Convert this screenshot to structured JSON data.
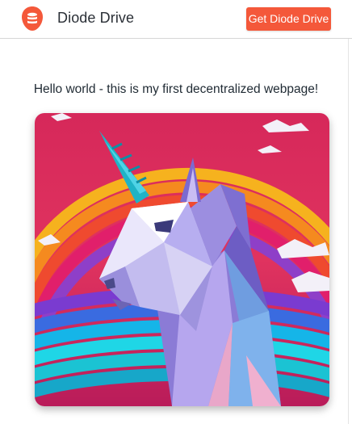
{
  "header": {
    "brand_name": "Diode Drive",
    "cta_label": "Get Diode Drive",
    "logo_icon": "database-icon"
  },
  "main": {
    "headline": "Hello world - this is my first decentralized webpage!",
    "hero_image": {
      "icon": "unicorn-rainbow-illustration"
    }
  },
  "colors": {
    "accent": "#f4583a",
    "text_dark": "#1f2a33",
    "divider": "#d6d6d6"
  }
}
